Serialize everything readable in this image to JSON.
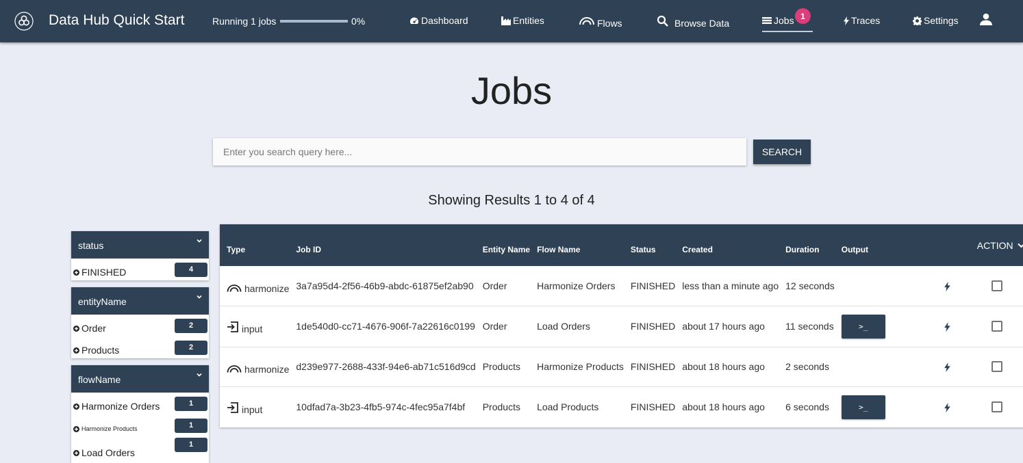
{
  "navbar": {
    "app_title": "Data Hub Quick Start",
    "running_label": "Running 1 jobs",
    "progress_percent": 0,
    "progress_label": "0%",
    "items": [
      {
        "label": "Dashboard",
        "icon": "dashboard-icon"
      },
      {
        "label": "Entities",
        "icon": "factory-icon"
      },
      {
        "label": "Flows",
        "icon": "flow-arc-icon"
      },
      {
        "label": "Browse Data",
        "icon": "search-icon"
      },
      {
        "label": "Jobs",
        "icon": "jobs-list-icon",
        "active": true,
        "badge": "1"
      },
      {
        "label": "Traces",
        "icon": "bolt-icon"
      },
      {
        "label": "Settings",
        "icon": "gear-icon"
      }
    ],
    "user_icon": "user-icon"
  },
  "page": {
    "title": "Jobs",
    "search_placeholder": "Enter you search query here...",
    "search_value": "",
    "search_button": "SEARCH",
    "results_text": "Showing Results 1 to 4 of 4"
  },
  "facets": [
    {
      "name": "status",
      "items": [
        {
          "label": "FINISHED",
          "count": "4"
        }
      ]
    },
    {
      "name": "entityName",
      "items": [
        {
          "label": "Order",
          "count": "2"
        },
        {
          "label": "Products",
          "count": "2"
        }
      ]
    },
    {
      "name": "flowName",
      "items": [
        {
          "label": "Harmonize Orders",
          "count": "1"
        },
        {
          "label": "Harmonize Products",
          "count": "1"
        },
        {
          "label": "Load Orders",
          "count": "1"
        }
      ]
    }
  ],
  "table": {
    "headers": [
      "Type",
      "Job ID",
      "Entity Name",
      "Flow Name",
      "Status",
      "Created",
      "Duration",
      "Output",
      "ACTION"
    ],
    "output_button_label": ">_",
    "rows": [
      {
        "type": "harmonize",
        "job_id": "3a7a95d4-2f56-46b9-abdc-61875ef2ab90",
        "entity": "Order",
        "flow": "Harmonize Orders",
        "status": "FINISHED",
        "created": "less than a minute ago",
        "duration": "12 seconds",
        "has_output": false
      },
      {
        "type": "input",
        "job_id": "1de540d0-cc71-4676-906f-7a22616c0199",
        "entity": "Order",
        "flow": "Load Orders",
        "status": "FINISHED",
        "created": "about 17 hours ago",
        "duration": "11 seconds",
        "has_output": true
      },
      {
        "type": "harmonize",
        "job_id": "d239e977-2688-433f-94e6-ab71c516d9cd",
        "entity": "Products",
        "flow": "Harmonize Products",
        "status": "FINISHED",
        "created": "about 18 hours ago",
        "duration": "2 seconds",
        "has_output": false
      },
      {
        "type": "input",
        "job_id": "10dfad7a-3b23-4fb5-974c-4fec95a7f4bf",
        "entity": "Products",
        "flow": "Load Products",
        "status": "FINISHED",
        "created": "about 18 hours ago",
        "duration": "6 seconds",
        "has_output": true
      }
    ]
  }
}
